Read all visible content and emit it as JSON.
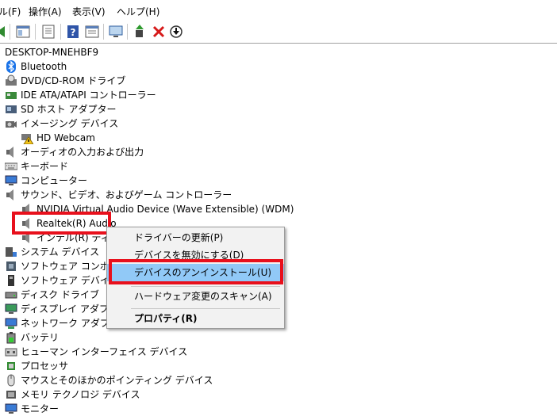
{
  "menubar": {
    "items": [
      "ル(F)",
      "操作(A)",
      "表示(V)",
      "ヘルプ(H)"
    ]
  },
  "toolbar": {
    "icons": [
      "back-arrow-icon",
      "window-icon",
      "properties-icon",
      "help-icon",
      "window-list-icon",
      "monitor-icon",
      "update-driver-icon",
      "uninstall-x-icon",
      "download-icon"
    ]
  },
  "tree": {
    "root": "DESKTOP-MNEHBF9",
    "items": [
      {
        "label": "Bluetooth",
        "icon": "bluetooth-icon"
      },
      {
        "label": "DVD/CD-ROM ドライブ",
        "icon": "dvd-drive-icon"
      },
      {
        "label": "IDE ATA/ATAPI コントローラー",
        "icon": "ide-controller-icon"
      },
      {
        "label": "SD ホスト アダプター",
        "icon": "sd-host-icon"
      },
      {
        "label": "イメージング デバイス",
        "icon": "camera-icon"
      },
      {
        "label": "HD Webcam",
        "icon": "webcam-warning-icon"
      },
      {
        "label": "オーディオの入力および出力",
        "icon": "speaker-icon"
      },
      {
        "label": "キーボード",
        "icon": "keyboard-icon"
      },
      {
        "label": "コンピューター",
        "icon": "computer-icon"
      },
      {
        "label": "サウンド、ビデオ、およびゲーム コントローラー",
        "icon": "speaker-icon"
      },
      {
        "label": "NVIDIA Virtual Audio Device (Wave Extensible) (WDM)",
        "icon": "speaker-icon"
      },
      {
        "label": "Realtek(R) Audio",
        "icon": "speaker-icon"
      },
      {
        "label": "インテル(R) ディスプ",
        "icon": "speaker-icon"
      },
      {
        "label": "システム デバイス",
        "icon": "system-device-icon"
      },
      {
        "label": "ソフトウェア コンポーネ",
        "icon": "software-component-icon"
      },
      {
        "label": "ソフトウェア デバイス",
        "icon": "software-device-icon"
      },
      {
        "label": "ディスク ドライブ",
        "icon": "disk-drive-icon"
      },
      {
        "label": "ディスプレイ アダプター",
        "icon": "display-adapter-icon"
      },
      {
        "label": "ネットワーク アダプター",
        "icon": "network-adapter-icon"
      },
      {
        "label": "バッテリ",
        "icon": "battery-icon"
      },
      {
        "label": "ヒューマン インターフェイス デバイス",
        "icon": "hid-icon"
      },
      {
        "label": "プロセッサ",
        "icon": "processor-icon"
      },
      {
        "label": "マウスとそのほかのポインティング デバイス",
        "icon": "mouse-icon"
      },
      {
        "label": "メモリ テクノロジ デバイス",
        "icon": "memory-icon"
      },
      {
        "label": "モニター",
        "icon": "monitor-icon"
      }
    ]
  },
  "context_menu": {
    "update_driver": "ドライバーの更新(P)",
    "disable_device": "デバイスを無効にする(D)",
    "uninstall_device": "デバイスのアンインストール(U)",
    "scan_hardware": "ハードウェア変更のスキャン(A)",
    "properties": "プロパティ(R)"
  },
  "colors": {
    "highlight_box": "#e8101c",
    "menu_selection": "#91c9f7"
  }
}
